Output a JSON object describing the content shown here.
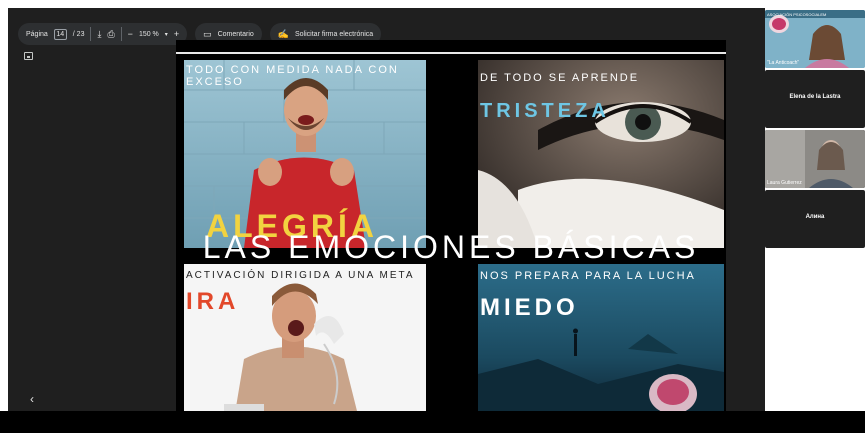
{
  "toolbar": {
    "page_label": "Página",
    "page_current": "14",
    "page_total": "/ 23",
    "zoom": "150 %",
    "zoom_minus": "−",
    "zoom_plus": "+",
    "comment_label": "Comentario",
    "sign_label": "Solicitar firma electrónica"
  },
  "slide": {
    "alegria_caption": "TODO CON MEDIDA NADA CON EXCESO",
    "alegria_word": "ALEGRÍA",
    "tristeza_caption": "DE TODO SE APRENDE",
    "tristeza_word": "TRISTEZA",
    "title": "LAS EMOCIONES BÁSICAS",
    "ira_caption": "ACTIVACIÓN DIRIGIDA A UNA META",
    "ira_word": "IRA",
    "miedo_caption": "NOS PREPARA PARA LA LUCHA",
    "miedo_word": "MIEDO"
  },
  "participants": [
    {
      "name": "\"La Anticoach\"",
      "banner": "ASOCIACIÓN PSICOSOCIALEM"
    },
    {
      "name": "Elena de la Lastra"
    },
    {
      "name": "Laura Gutierrez"
    },
    {
      "name": "Алина"
    }
  ],
  "colors": {
    "alegria": "#f2d340",
    "tristeza": "#6ec6e4",
    "ira": "#e2482a",
    "miedo": "#ffffff"
  }
}
